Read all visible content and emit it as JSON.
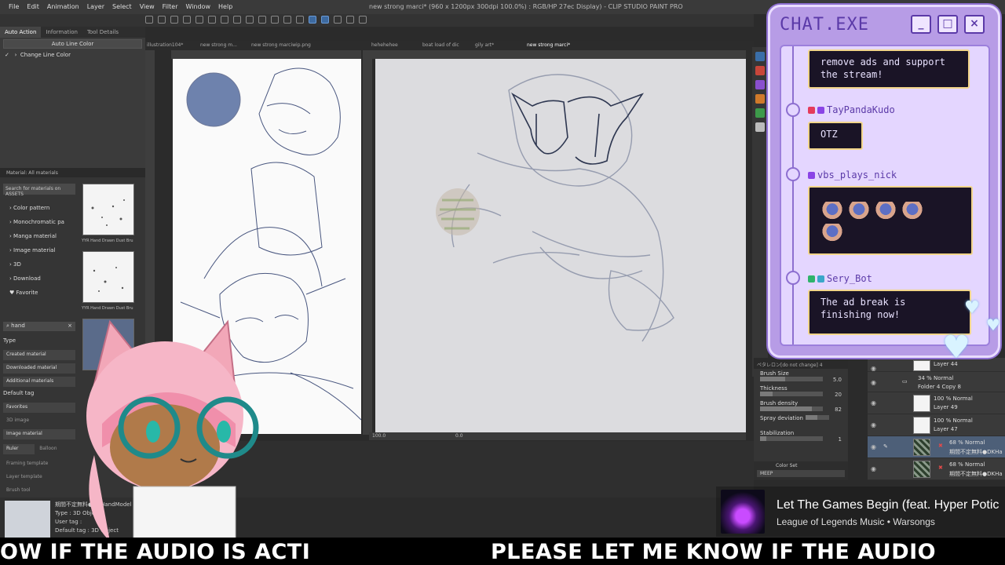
{
  "app": {
    "menu": [
      "File",
      "Edit",
      "Animation",
      "Layer",
      "Select",
      "View",
      "Filter",
      "Window",
      "Help"
    ],
    "title": "new strong marci* (960 x 1200px 300dpi 100.0%) : RGB/HP 27ec Display) - CLIP STUDIO PAINT PRO"
  },
  "tool_panel": {
    "tabs": [
      "Auto Action",
      "Information",
      "Tool Details"
    ],
    "selected_action": "Auto Line Color",
    "item": "Change Line Color"
  },
  "materials": {
    "header": "Material: All materials",
    "search_placeholder": "Search for materials on ASSETS",
    "tree": [
      "Color pattern",
      "Monochromatic pa",
      "Manga material",
      "Image material",
      "3D",
      "Download",
      "Favorite"
    ],
    "search_value": "hand",
    "type_label": "Type",
    "types": [
      "Created material",
      "Downloaded material",
      "Additional materials"
    ],
    "default_tag": "Default tag",
    "tags": [
      "Favorites",
      "3D image",
      "Image material",
      "Ruler",
      "Balloon",
      "Framing template",
      "Layer template",
      "Brush tool"
    ],
    "thumb_labels": [
      "YYR Hand Drawn Dust Bru",
      "YYR Hand Drawn Dust Bru"
    ],
    "info": [
      "期間不定無料●DKHandModel",
      "Type : 3D Object",
      "User tag :",
      "Default tag : 3D Object"
    ]
  },
  "canvas": {
    "tabs": [
      "illustration104*",
      "new strong m...",
      "new strong marciwip.png",
      "hehehehee",
      "boat load of dic",
      "gily art*",
      "new strong marci*"
    ],
    "zoom": "100.0",
    "rotation": "0.0"
  },
  "tool_property": {
    "header": "ペタレロン[do not change] 4",
    "rows": [
      {
        "label": "Brush Size",
        "value": "5.0",
        "fill": 0.4
      },
      {
        "label": "Thickness",
        "value": "20",
        "fill": 0.2
      },
      {
        "label": "Brush density",
        "value": "82",
        "fill": 0.82
      },
      {
        "label": "Spray deviation",
        "value": "",
        "fill": 0.5
      },
      {
        "label": "Stabilization",
        "value": "1",
        "fill": 0.1
      }
    ],
    "color_set": "Color Set",
    "color_set_value": "MEEP"
  },
  "layers": [
    {
      "line1": "Layer 44",
      "line2": "",
      "dark": false,
      "selected": false
    },
    {
      "line1": "34 % Normal",
      "line2": "Folder 4 Copy 8",
      "dark": false,
      "selected": false
    },
    {
      "line1": "100 % Normal",
      "line2": "Layer 49",
      "dark": false,
      "selected": false
    },
    {
      "line1": "100 % Normal",
      "line2": "Layer 47",
      "dark": false,
      "selected": false
    },
    {
      "line1": "68 % Normal",
      "line2": "期間不定無料●DKHa",
      "dark": true,
      "selected": true
    },
    {
      "line1": "68 % Normal",
      "line2": "期間不定無料●DKHa",
      "dark": true,
      "selected": false
    }
  ],
  "chat": {
    "title": "CHAT.EXE",
    "buttons": [
      "_",
      "□",
      "×"
    ],
    "messages": [
      {
        "user": "",
        "text": "remove ads and support the stream!"
      },
      {
        "user": "TayPandaKudo",
        "text": "OTZ"
      },
      {
        "user": "vbs_plays_nick",
        "text": ""
      },
      {
        "user": "Sery_Bot",
        "text": "The ad break is finishing now!"
      }
    ],
    "badge_colors": [
      "#e53b5b",
      "#8a44e6",
      "#2fb36b",
      "#3aa7c9"
    ]
  },
  "now_playing": {
    "title": "Let The Games Begin (feat. Hyper Potic",
    "subtitle": "League of Legends Music • Warsongs"
  },
  "ticker": {
    "segment_a": "OW IF THE AUDIO IS ACTI",
    "segment_b": "PLEASE LET ME KNOW IF THE AUDIO"
  },
  "colors": {
    "chat_frame": "#b79ce6",
    "chat_inner": "#e4d6ff",
    "chat_accent": "#5b3aa8",
    "message_bg": "#1a1426",
    "message_border": "#f2d58a"
  }
}
